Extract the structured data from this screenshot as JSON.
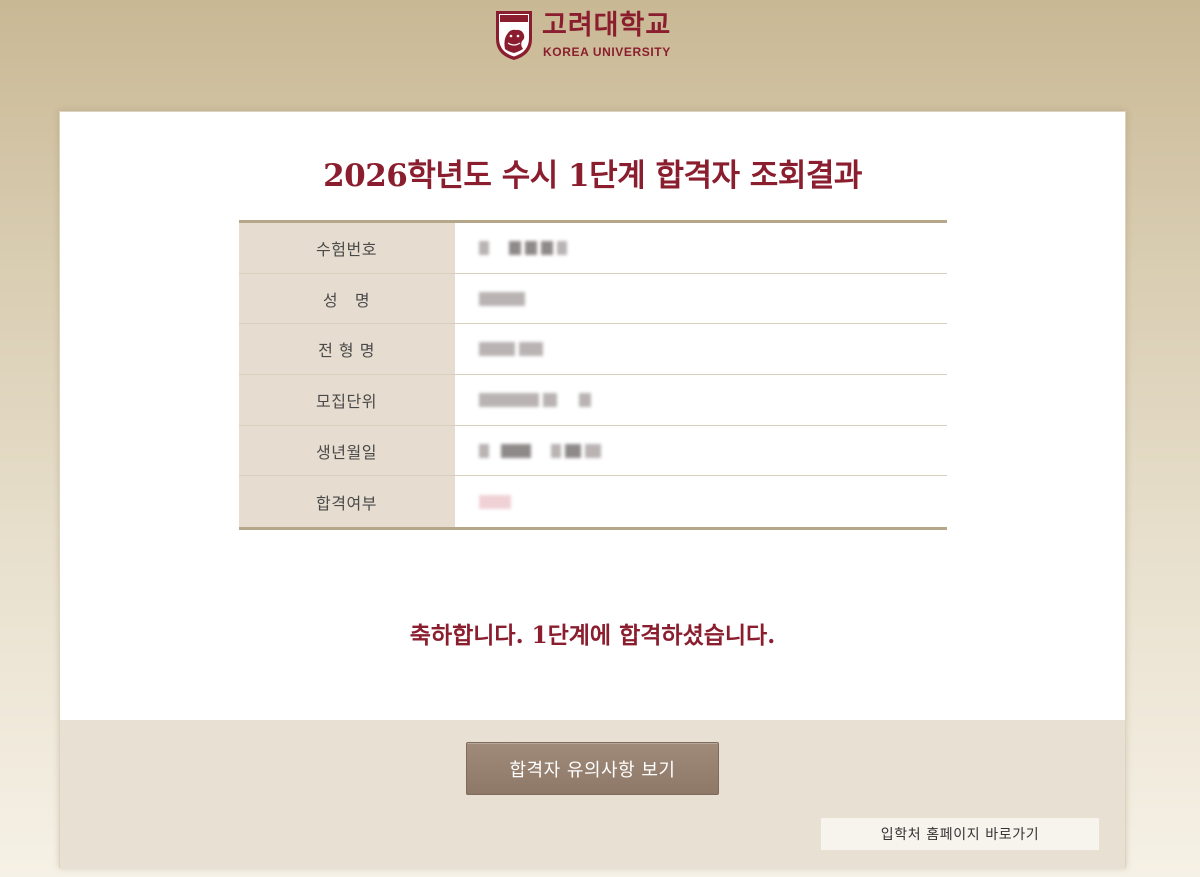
{
  "header": {
    "logo_korean": "고려대학교",
    "logo_english": "KOREA UNIVERSITY",
    "seal_text": "KOREA UNIVERSITY"
  },
  "page": {
    "title": "2026학년도 수시 1단계 합격자 조회결과"
  },
  "info_table": {
    "rows": [
      {
        "label": "수험번호",
        "value": ""
      },
      {
        "label": "성   명",
        "value": ""
      },
      {
        "label": "전 형 명",
        "value": ""
      },
      {
        "label": "모집단위",
        "value": ""
      },
      {
        "label": "생년월일",
        "value": ""
      },
      {
        "label": "합격여부",
        "value": ""
      }
    ]
  },
  "result": {
    "message": "축하합니다. 1단계에 합격하셨습니다."
  },
  "actions": {
    "notice_button_label": "합격자 유의사항 보기",
    "home_link_label": "입학처 홈페이지 바로가기"
  },
  "colors": {
    "brand": "#8b1e2e",
    "label_bg": "#e6ddd0",
    "button_bg": "#9a8474",
    "band_bg": "#e8e0d2"
  },
  "icons": {
    "seal": "tiger-seal-icon"
  }
}
